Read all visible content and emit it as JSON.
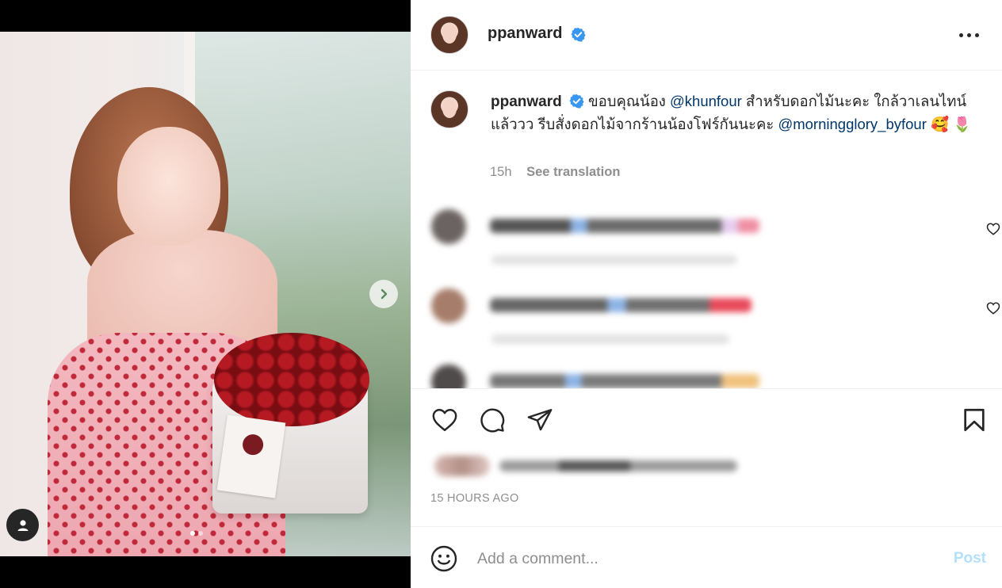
{
  "post": {
    "username": "ppanward",
    "verified": true,
    "caption_parts": {
      "p1": "ขอบคุณน้อง",
      "mention1": "@khunfour",
      "p2": "สำหรับดอกไม้นะคะ ใกล้วาเลนไทน์แล้ววว รีบสั่งดอกไม้จากร้านน้องโฟร์กันนะคะ",
      "mention2": "@morningglory_byfour",
      "emojis": "🥰 🌷"
    },
    "caption_age": "15h",
    "see_translation": "See translation",
    "timestamp": "15 HOURS AGO"
  },
  "media": {
    "carousel_count": 2,
    "carousel_active": 0
  },
  "comment_box": {
    "placeholder": "Add a comment...",
    "post_label": "Post"
  },
  "colors": {
    "verified": "#3897f0",
    "mention": "#00376b",
    "post_disabled": "#b2dffc",
    "meta_gray": "#8e8e8e"
  },
  "icons": {
    "like": "heart-icon",
    "comment": "comment-icon",
    "share": "paper-plane-icon",
    "save": "bookmark-icon",
    "emoji": "smiley-icon",
    "more": "more-horizontal-icon",
    "next": "chevron-right-icon",
    "tag": "user-tag-icon"
  }
}
